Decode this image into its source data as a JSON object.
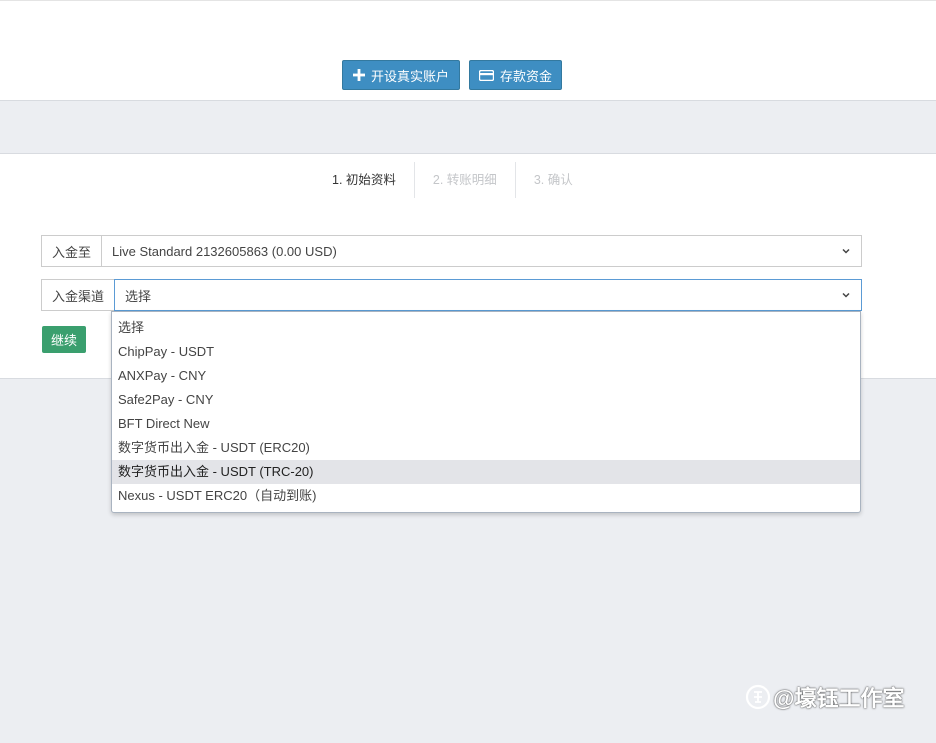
{
  "actions": {
    "open_account_label": "开设真实账户",
    "deposit_label": "存款资金"
  },
  "steps": [
    {
      "label": "1. 初始资料",
      "state": "active"
    },
    {
      "label": "2. 转账明细",
      "state": "inactive"
    },
    {
      "label": "3. 确认",
      "state": "inactive"
    }
  ],
  "form": {
    "deposit_to": {
      "label": "入金至",
      "value": "Live Standard 2132605863 (0.00 USD)"
    },
    "channel": {
      "label": "入金渠道",
      "value": "选择",
      "options": [
        "选择",
        "ChipPay - USDT",
        "ANXPay - CNY",
        "Safe2Pay - CNY",
        "BFT Direct New",
        "数字货币出入金 - USDT (ERC20)",
        "数字货币出入金 - USDT (TRC-20)",
        "Nexus - USDT ERC20（自动到账)"
      ],
      "highlighted_index": 6
    },
    "continue_label": "继续"
  },
  "watermark": {
    "text": "@壕钰工作室",
    "icon": "zhihu-logo-icon"
  },
  "colors": {
    "primary_button": "#3e8ec2",
    "success_button": "#3a9f6e",
    "page_background": "#eceef2",
    "highlight": "#e3e4e8"
  }
}
